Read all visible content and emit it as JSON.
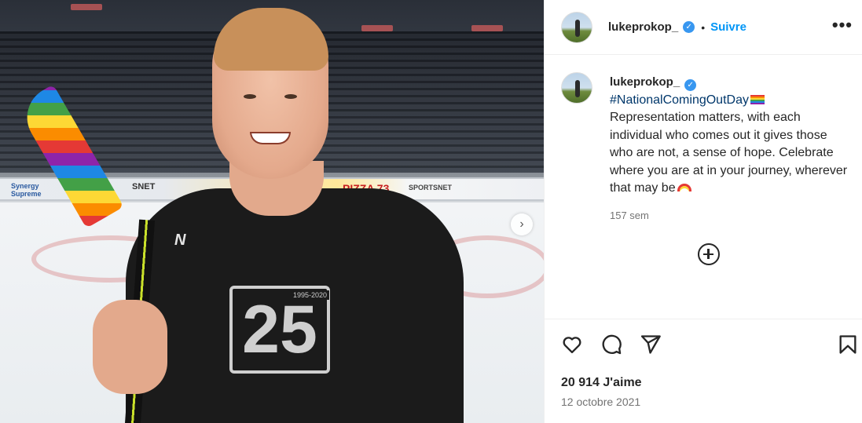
{
  "post": {
    "username": "lukeprokop_",
    "verified": true,
    "separator": "•",
    "follow_label": "Suivre",
    "more_label": "•••"
  },
  "photo": {
    "board_texts": [
      "Synergy Supreme",
      "SNET",
      "PIZZA 73",
      "SPORTSNET"
    ],
    "shirt_years": "1995-2020",
    "shirt_number": "25",
    "next_icon": "chevron-right-icon"
  },
  "caption": {
    "username": "lukeprokop_",
    "hashtag": "#NationalComingOutDay",
    "text": "Representation matters, with each individual who comes out it gives those who are not, a sense of hope. Celebrate where you are at in your journey, wherever that may be",
    "age": "157 sem"
  },
  "comments": {
    "load_more_icon": "plus-circle-icon"
  },
  "actions": {
    "icons": [
      "heart-icon",
      "comment-icon",
      "share-icon",
      "bookmark-icon"
    ],
    "likes_count": "20 914",
    "likes_label": "J'aime",
    "date": "12 octobre 2021"
  },
  "colors": {
    "accent": "#0095f6",
    "hashtag": "#00376b",
    "verified": "#3897f0",
    "muted": "#737373"
  }
}
